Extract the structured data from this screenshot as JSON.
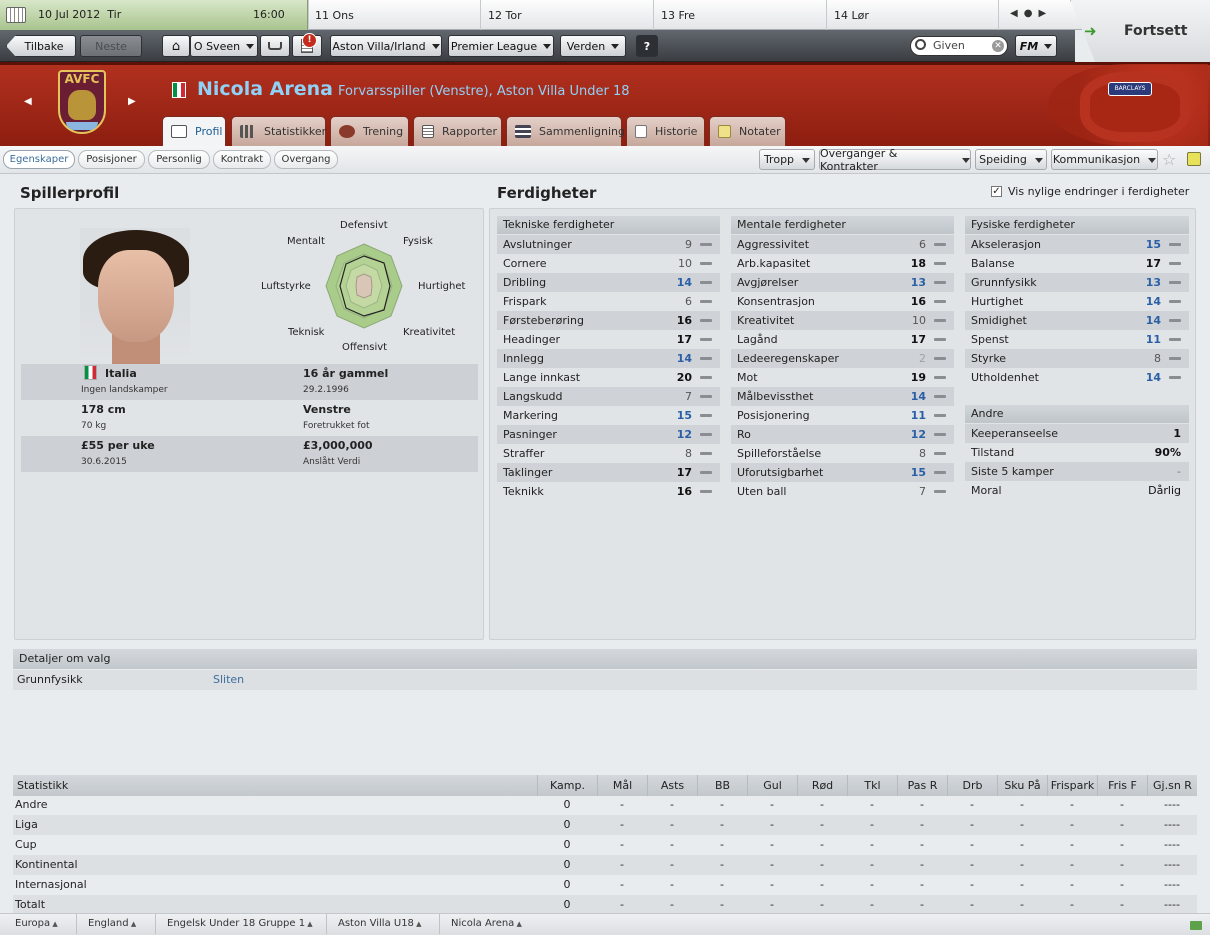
{
  "calendar": {
    "date": "10 Jul 2012",
    "weekday": "Tir",
    "time": "16:00",
    "days": [
      "11 Ons",
      "12 Tor",
      "13 Fre",
      "14 Lør"
    ]
  },
  "continue_label": "Fortsett",
  "toolbar": {
    "back": "Tilbake",
    "forward": "Neste",
    "manager": "O Sveen",
    "club": "Aston Villa/Irland",
    "league": "Premier League",
    "world": "Verden",
    "help": "?",
    "search_placeholder": "Given",
    "fm": "FM",
    "alert_badge": "!"
  },
  "club_badge": "AVFC",
  "player": {
    "name": "Nicola Arena",
    "position": "Forvarsspiller (Venstre), Aston Villa Under 18"
  },
  "tabs": [
    "Profil",
    "Statistikker",
    "Trening",
    "Rapporter",
    "Sammenligning",
    "Historie",
    "Notater"
  ],
  "subtabs": [
    "Egenskaper",
    "Posisjoner",
    "Personlig",
    "Kontrakt",
    "Overgang"
  ],
  "menus": [
    "Tropp",
    "Overganger & Kontrakter",
    "Speiding",
    "Kommunikasjon"
  ],
  "profile": {
    "title": "Spillerprofil",
    "radar_labels": [
      "Defensivt",
      "Fysisk",
      "Hurtighet",
      "Kreativitet",
      "Offensivt",
      "Teknisk",
      "Luftstyrke",
      "Mentalt"
    ],
    "info": [
      {
        "l1": "Italia",
        "l2": "Ingen landskamper",
        "r1": "16 år gammel",
        "r2": "29.2.1996"
      },
      {
        "l1": "178 cm",
        "l2": "70 kg",
        "r1": "Venstre",
        "r2": "Foretrukket fot"
      },
      {
        "l1": "£55 per uke",
        "l2": "30.6.2015",
        "r1": "£3,000,000",
        "r2": "Anslått Verdi"
      }
    ]
  },
  "skills": {
    "title": "Ferdigheter",
    "checkbox_label": "Vis nylige endringer i ferdigheter",
    "technical": {
      "title": "Tekniske ferdigheter",
      "items": [
        {
          "name": "Avslutninger",
          "value": "9"
        },
        {
          "name": "Cornere",
          "value": "10"
        },
        {
          "name": "Dribling",
          "value": "14"
        },
        {
          "name": "Frispark",
          "value": "6"
        },
        {
          "name": "Førsteberøring",
          "value": "16"
        },
        {
          "name": "Headinger",
          "value": "17"
        },
        {
          "name": "Innlegg",
          "value": "14"
        },
        {
          "name": "Lange innkast",
          "value": "20"
        },
        {
          "name": "Langskudd",
          "value": "7"
        },
        {
          "name": "Markering",
          "value": "15"
        },
        {
          "name": "Pasninger",
          "value": "12"
        },
        {
          "name": "Straffer",
          "value": "8"
        },
        {
          "name": "Taklinger",
          "value": "17"
        },
        {
          "name": "Teknikk",
          "value": "16"
        }
      ]
    },
    "mental": {
      "title": "Mentale ferdigheter",
      "items": [
        {
          "name": "Aggressivitet",
          "value": "6"
        },
        {
          "name": "Arb.kapasitet",
          "value": "18"
        },
        {
          "name": "Avgjørelser",
          "value": "13"
        },
        {
          "name": "Konsentrasjon",
          "value": "16"
        },
        {
          "name": "Kreativitet",
          "value": "10"
        },
        {
          "name": "Lagånd",
          "value": "17"
        },
        {
          "name": "Ledeeregenskaper",
          "value": "2"
        },
        {
          "name": "Mot",
          "value": "19"
        },
        {
          "name": "Målbevissthet",
          "value": "14"
        },
        {
          "name": "Posisjonering",
          "value": "11"
        },
        {
          "name": "Ro",
          "value": "12"
        },
        {
          "name": "Spilleforståelse",
          "value": "8"
        },
        {
          "name": "Uforutsigbarhet",
          "value": "15"
        },
        {
          "name": "Uten ball",
          "value": "7"
        }
      ]
    },
    "physical": {
      "title": "Fysiske ferdigheter",
      "items": [
        {
          "name": "Akselerasjon",
          "value": "15"
        },
        {
          "name": "Balanse",
          "value": "17"
        },
        {
          "name": "Grunnfysikk",
          "value": "13"
        },
        {
          "name": "Hurtighet",
          "value": "14"
        },
        {
          "name": "Smidighet",
          "value": "14"
        },
        {
          "name": "Spenst",
          "value": "11"
        },
        {
          "name": "Styrke",
          "value": "8"
        },
        {
          "name": "Utholdenhet",
          "value": "14"
        }
      ]
    },
    "other": {
      "title": "Andre",
      "items": [
        {
          "name": "Keeperanseelse",
          "value": "1"
        },
        {
          "name": "Tilstand",
          "value": "90%"
        },
        {
          "name": "Siste 5 kamper",
          "value": "-"
        },
        {
          "name": "Moral",
          "value": "Dårlig"
        }
      ]
    }
  },
  "details": {
    "title": "Detaljer om valg",
    "label": "Grunnfysikk",
    "value": "Sliten"
  },
  "stats": {
    "headers": [
      "Statistikk",
      "Kamp.",
      "Mål",
      "Asts",
      "BB",
      "Gul",
      "Rød",
      "Tkl",
      "Pas R",
      "Drb",
      "Sku På",
      "Frispark",
      "Fris F",
      "Gj.sn R"
    ],
    "rows": [
      {
        "name": "Andre",
        "cells": [
          "0",
          "-",
          "-",
          "-",
          "-",
          "-",
          "-",
          "-",
          "-",
          "-",
          "-",
          "-",
          "----"
        ]
      },
      {
        "name": "Liga",
        "cells": [
          "0",
          "-",
          "-",
          "-",
          "-",
          "-",
          "-",
          "-",
          "-",
          "-",
          "-",
          "-",
          "----"
        ]
      },
      {
        "name": "Cup",
        "cells": [
          "0",
          "-",
          "-",
          "-",
          "-",
          "-",
          "-",
          "-",
          "-",
          "-",
          "-",
          "-",
          "----"
        ]
      },
      {
        "name": "Kontinental",
        "cells": [
          "0",
          "-",
          "-",
          "-",
          "-",
          "-",
          "-",
          "-",
          "-",
          "-",
          "-",
          "-",
          "----"
        ]
      },
      {
        "name": "Internasjonal",
        "cells": [
          "0",
          "-",
          "-",
          "-",
          "-",
          "-",
          "-",
          "-",
          "-",
          "-",
          "-",
          "-",
          "----"
        ]
      },
      {
        "name": "Totalt",
        "cells": [
          "0",
          "-",
          "-",
          "-",
          "-",
          "-",
          "-",
          "-",
          "-",
          "-",
          "-",
          "-",
          "----"
        ]
      }
    ]
  },
  "breadcrumb": [
    "Europa",
    "England",
    "Engelsk Under 18 Gruppe 1",
    "Aston Villa U18",
    "Nicola Arena"
  ],
  "colors": {
    "header_red": "#a6281a",
    "name_blue": "#8fd2f7",
    "value_blue": "#2a5fa6",
    "continue_green": "#3a9a2a"
  }
}
